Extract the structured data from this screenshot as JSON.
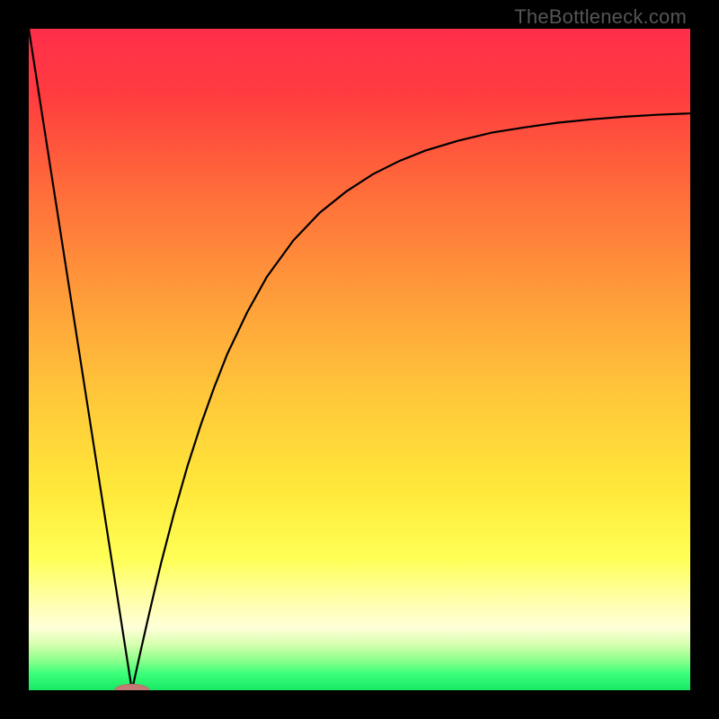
{
  "watermark": "TheBottleneck.com",
  "colors": {
    "frame": "#000000",
    "curve": "#000000",
    "marker_fill": "#C47A75",
    "marker_stroke": "#B86C67",
    "gradient_stops": [
      {
        "offset": 0.0,
        "color": "#FF2E4A"
      },
      {
        "offset": 0.1,
        "color": "#FF3C3F"
      },
      {
        "offset": 0.25,
        "color": "#FF6E3A"
      },
      {
        "offset": 0.4,
        "color": "#FF9B3A"
      },
      {
        "offset": 0.55,
        "color": "#FFC63A"
      },
      {
        "offset": 0.7,
        "color": "#FFE93A"
      },
      {
        "offset": 0.8,
        "color": "#FFFF55"
      },
      {
        "offset": 0.86,
        "color": "#FFFFA5"
      },
      {
        "offset": 0.905,
        "color": "#FFFFD8"
      },
      {
        "offset": 0.93,
        "color": "#D8FFB0"
      },
      {
        "offset": 0.955,
        "color": "#8CFF8C"
      },
      {
        "offset": 0.975,
        "color": "#3CFF7A"
      },
      {
        "offset": 1.0,
        "color": "#18E865"
      }
    ]
  },
  "chart_data": {
    "type": "line",
    "title": "",
    "xlabel": "",
    "ylabel": "",
    "xlim": [
      0,
      100
    ],
    "ylim": [
      0,
      100
    ],
    "x_minimum": 15.6,
    "left_line": {
      "x": [
        0.0,
        15.6
      ],
      "y": [
        100.0,
        0.0
      ]
    },
    "curve": {
      "x": [
        15.6,
        17,
        18,
        19,
        20,
        22,
        24,
        26,
        28,
        30,
        33,
        36,
        40,
        44,
        48,
        52,
        56,
        60,
        65,
        70,
        75,
        80,
        85,
        90,
        95,
        100
      ],
      "y": [
        0.0,
        6.3,
        10.7,
        15.0,
        19.2,
        26.9,
        33.9,
        40.1,
        45.7,
        50.8,
        57.1,
        62.5,
        68.0,
        72.2,
        75.4,
        78.0,
        80.0,
        81.6,
        83.1,
        84.3,
        85.1,
        85.8,
        86.3,
        86.7,
        87.0,
        87.2
      ]
    },
    "marker": {
      "cx": 15.6,
      "cy": 0.0,
      "rx_pct": 2.6,
      "ry_pct": 0.9
    }
  }
}
